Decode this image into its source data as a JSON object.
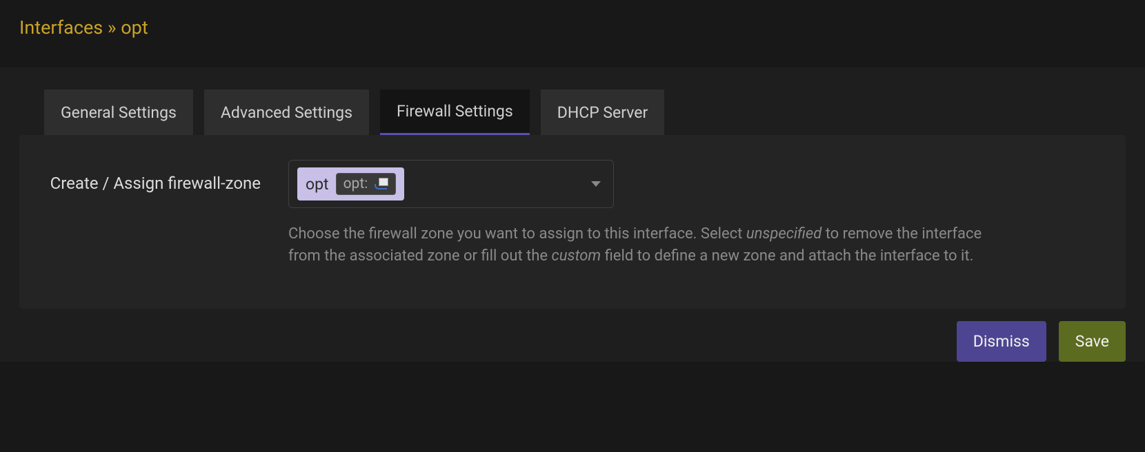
{
  "breadcrumb": {
    "section": "Interfaces",
    "separator": "»",
    "item": "opt"
  },
  "tabs": [
    {
      "label": "General Settings",
      "active": false
    },
    {
      "label": "Advanced Settings",
      "active": false
    },
    {
      "label": "Firewall Settings",
      "active": true
    },
    {
      "label": "DHCP Server",
      "active": false
    }
  ],
  "form": {
    "zone_label": "Create / Assign firewall-zone",
    "zone_value": {
      "name": "opt",
      "iface_label": "opt:"
    },
    "help_pre": "Choose the firewall zone you want to assign to this interface. Select ",
    "help_em1": "unspecified",
    "help_mid": " to remove the interface from the associated zone or fill out the ",
    "help_em2": "custom",
    "help_post": " field to define a new zone and attach the interface to it."
  },
  "buttons": {
    "dismiss": "Dismiss",
    "save": "Save"
  }
}
